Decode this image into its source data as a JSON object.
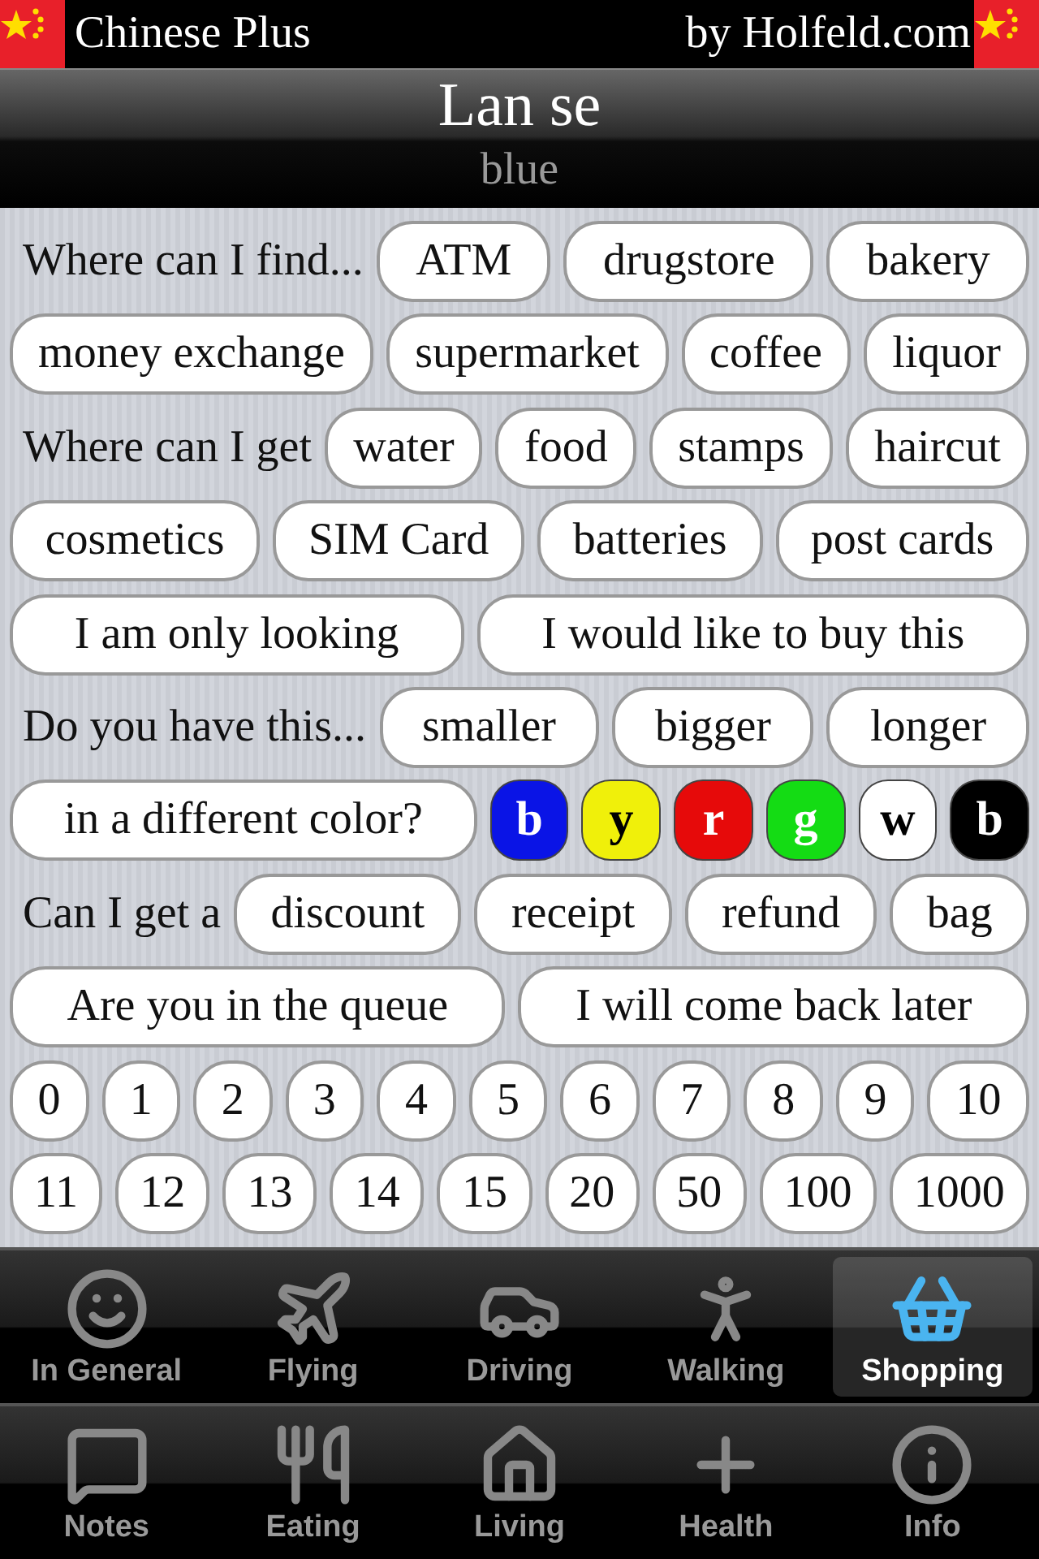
{
  "header": {
    "app_name": "Chinese Plus",
    "credit": "by Holfeld.com"
  },
  "phrase": {
    "pinyin": "Lan se",
    "translation": "blue"
  },
  "rows": [
    [
      {
        "kind": "label",
        "text": "Where can I find..."
      },
      {
        "kind": "pill",
        "text": "ATM"
      },
      {
        "kind": "pill",
        "text": "drugstore"
      },
      {
        "kind": "pill",
        "text": "bakery"
      }
    ],
    [
      {
        "kind": "pill",
        "text": "money exchange"
      },
      {
        "kind": "pill",
        "text": "supermarket"
      },
      {
        "kind": "pill",
        "text": "coffee"
      },
      {
        "kind": "pill",
        "text": "liquor"
      }
    ],
    [
      {
        "kind": "label",
        "text": "Where can I get"
      },
      {
        "kind": "pill",
        "text": "water"
      },
      {
        "kind": "pill",
        "text": "food"
      },
      {
        "kind": "pill",
        "text": "stamps"
      },
      {
        "kind": "pill",
        "text": "haircut"
      }
    ],
    [
      {
        "kind": "pill",
        "text": "cosmetics"
      },
      {
        "kind": "pill",
        "text": "SIM Card"
      },
      {
        "kind": "pill",
        "text": "batteries"
      },
      {
        "kind": "pill",
        "text": "post cards"
      }
    ],
    [
      {
        "kind": "pill",
        "text": "I am only looking"
      },
      {
        "kind": "pill",
        "text": "I would like to buy this"
      }
    ],
    [
      {
        "kind": "label",
        "text": "Do you have this..."
      },
      {
        "kind": "pill",
        "text": "smaller"
      },
      {
        "kind": "pill",
        "text": "bigger"
      },
      {
        "kind": "pill",
        "text": "longer"
      }
    ],
    [
      {
        "kind": "pill",
        "text": "in a different color?"
      },
      {
        "kind": "color",
        "text": "b",
        "color": "#0a14e6"
      },
      {
        "kind": "color",
        "text": "y",
        "color": "#f0f00a"
      },
      {
        "kind": "color",
        "text": "r",
        "color": "#e60a0a"
      },
      {
        "kind": "color",
        "text": "g",
        "color": "#14dc14"
      },
      {
        "kind": "color",
        "text": "w",
        "color": "#ffffff"
      },
      {
        "kind": "color",
        "text": "b",
        "color": "#000000"
      }
    ],
    [
      {
        "kind": "label",
        "text": "Can I get a"
      },
      {
        "kind": "pill",
        "text": "discount"
      },
      {
        "kind": "pill",
        "text": "receipt"
      },
      {
        "kind": "pill",
        "text": "refund"
      },
      {
        "kind": "pill",
        "text": "bag"
      }
    ],
    [
      {
        "kind": "pill",
        "text": "Are you in the queue"
      },
      {
        "kind": "pill",
        "text": "I will come back later"
      }
    ],
    [
      {
        "kind": "pill",
        "text": "0"
      },
      {
        "kind": "pill",
        "text": "1"
      },
      {
        "kind": "pill",
        "text": "2"
      },
      {
        "kind": "pill",
        "text": "3"
      },
      {
        "kind": "pill",
        "text": "4"
      },
      {
        "kind": "pill",
        "text": "5"
      },
      {
        "kind": "pill",
        "text": "6"
      },
      {
        "kind": "pill",
        "text": "7"
      },
      {
        "kind": "pill",
        "text": "8"
      },
      {
        "kind": "pill",
        "text": "9"
      },
      {
        "kind": "pill",
        "text": "10"
      }
    ],
    [
      {
        "kind": "pill",
        "text": "11"
      },
      {
        "kind": "pill",
        "text": "12"
      },
      {
        "kind": "pill",
        "text": "13"
      },
      {
        "kind": "pill",
        "text": "14"
      },
      {
        "kind": "pill",
        "text": "15"
      },
      {
        "kind": "pill",
        "text": "20"
      },
      {
        "kind": "pill",
        "text": "50"
      },
      {
        "kind": "pill",
        "text": "100"
      },
      {
        "kind": "pill",
        "text": "1000"
      }
    ]
  ],
  "tab_bars": [
    [
      {
        "label": "In General",
        "selected": false
      },
      {
        "label": "Flying",
        "selected": false
      },
      {
        "label": "Driving",
        "selected": false
      },
      {
        "label": "Walking",
        "selected": false
      },
      {
        "label": "Shopping",
        "selected": true
      }
    ],
    [
      {
        "label": "Notes",
        "selected": false
      },
      {
        "label": "Eating",
        "selected": false
      },
      {
        "label": "Living",
        "selected": false
      },
      {
        "label": "Health",
        "selected": false
      },
      {
        "label": "Info",
        "selected": false
      }
    ]
  ]
}
